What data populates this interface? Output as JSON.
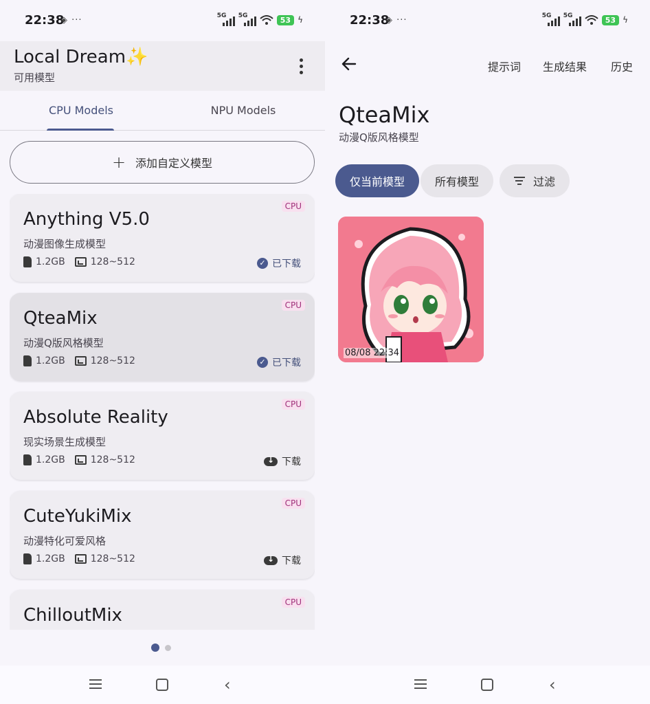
{
  "status_bar": {
    "time": "22:38",
    "battery": "53",
    "network": "5G"
  },
  "left": {
    "app_title": "Local Dream✨",
    "app_subtitle": "可用模型",
    "tabs": [
      {
        "label": "CPU Models"
      },
      {
        "label": "NPU Models"
      }
    ],
    "add_button_label": "添加自定义模型",
    "models": [
      {
        "name": "Anything V5.0",
        "desc": "动漫图像生成模型",
        "size": "1.2GB",
        "resolution": "128~512",
        "badge": "CPU",
        "status": "已下载"
      },
      {
        "name": "QteaMix",
        "desc": "动漫Q版风格模型",
        "size": "1.2GB",
        "resolution": "128~512",
        "badge": "CPU",
        "status": "已下载"
      },
      {
        "name": "Absolute Reality",
        "desc": "现实场景生成模型",
        "size": "1.2GB",
        "resolution": "128~512",
        "badge": "CPU",
        "status": "下载"
      },
      {
        "name": "CuteYukiMix",
        "desc": "动漫特化可爱风格",
        "size": "1.2GB",
        "resolution": "128~512",
        "badge": "CPU",
        "status": "下载"
      },
      {
        "name": "ChilloutMix",
        "badge": "CPU"
      }
    ]
  },
  "right": {
    "nav_links": [
      "提示词",
      "生成结果",
      "历史"
    ],
    "model_title": "QteaMix",
    "model_subtitle": "动漫Q版风格模型",
    "filters": [
      {
        "label": "仅当前模型"
      },
      {
        "label": "所有模型"
      },
      {
        "label": "过滤"
      }
    ],
    "results": [
      {
        "timestamp": "08/08 22:34"
      }
    ]
  },
  "colors": {
    "accent": "#4b5a8f",
    "badge_text": "#a0307a",
    "battery": "#3fc455"
  }
}
